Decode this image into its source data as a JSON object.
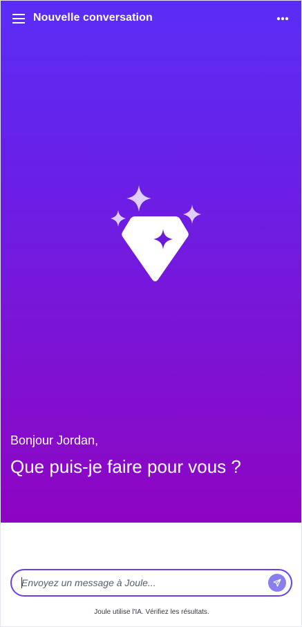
{
  "header": {
    "title": "Nouvelle conversation",
    "menu_icon": "hamburger-menu-icon",
    "more_icon": "more-options-icon"
  },
  "hero": {
    "logo_icon": "joule-diamond-sparkle-icon",
    "greeting": "Bonjour Jordan,",
    "prompt": "Que puis-je faire pour vous ?"
  },
  "composer": {
    "placeholder": "Envoyez un message à Joule...",
    "value": "",
    "send_icon": "send-icon"
  },
  "footer": {
    "disclaimer": "Joule utilise l'IA. Vérifiez les résultats."
  },
  "colors": {
    "gradient_top": "#5a2df6",
    "gradient_bottom": "#8d05c2",
    "input_border": "#6a3cf0",
    "send_button": "#8b7ff0"
  }
}
